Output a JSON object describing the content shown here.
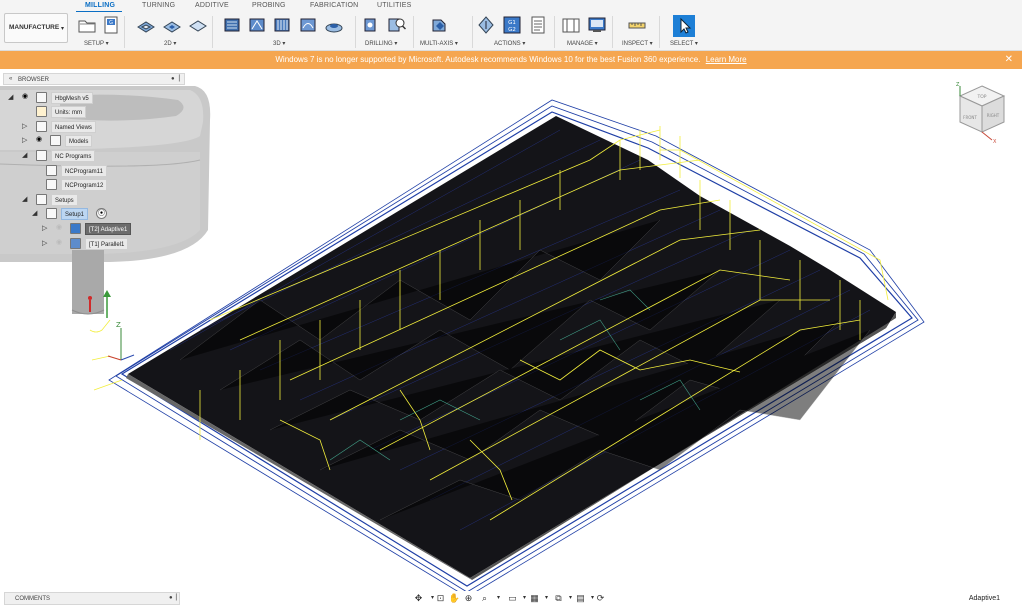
{
  "tabs": [
    {
      "label": "MILLING",
      "active": true
    },
    {
      "label": "TURNING",
      "active": false
    },
    {
      "label": "ADDITIVE",
      "active": false
    },
    {
      "label": "PROBING",
      "active": false
    },
    {
      "label": "FABRICATION",
      "active": false
    },
    {
      "label": "UTILITIES",
      "active": false
    }
  ],
  "workspace": {
    "label": "MANUFACTURE"
  },
  "toolbar_groups": [
    "SETUP",
    "2D",
    "3D",
    "DRILLING",
    "MULTI-AXIS",
    "ACTIONS",
    "MANAGE",
    "INSPECT",
    "SELECT"
  ],
  "notification": {
    "text": "Windows 7 is no longer supported by Microsoft. Autodesk recommends Windows 10 for the best Fusion 360 experience.",
    "link": "Learn More"
  },
  "browser": {
    "title": "BROWSER",
    "root": "HbgMesh v5",
    "units": "Units: mm",
    "named_views": "Named Views",
    "models": "Models",
    "nc_programs": "NC Programs",
    "nc_program_1": "NCProgram11",
    "nc_program_2": "NCProgram12",
    "setups": "Setups",
    "setup": "Setup1",
    "op_1": "[T2] Adaptive1",
    "op_2": "[T1] Parallel1"
  },
  "viewcube": {
    "top": "TOP",
    "front": "FRONT",
    "right": "RIGHT",
    "axis_x": "X",
    "axis_z": "Z"
  },
  "triad": {
    "axis_z": "Z",
    "axis_y": "Y",
    "axis_x": "X"
  },
  "comments": {
    "title": "COMMENTS"
  },
  "status": {
    "selection": "Adaptive1"
  },
  "colors": {
    "accent": "#0a6ec4",
    "notification": "#f5a650",
    "toolpath_rapid": "#f2ee3c",
    "toolpath_boundary": "#1f3fa6",
    "mesh_dark": "#141418"
  }
}
